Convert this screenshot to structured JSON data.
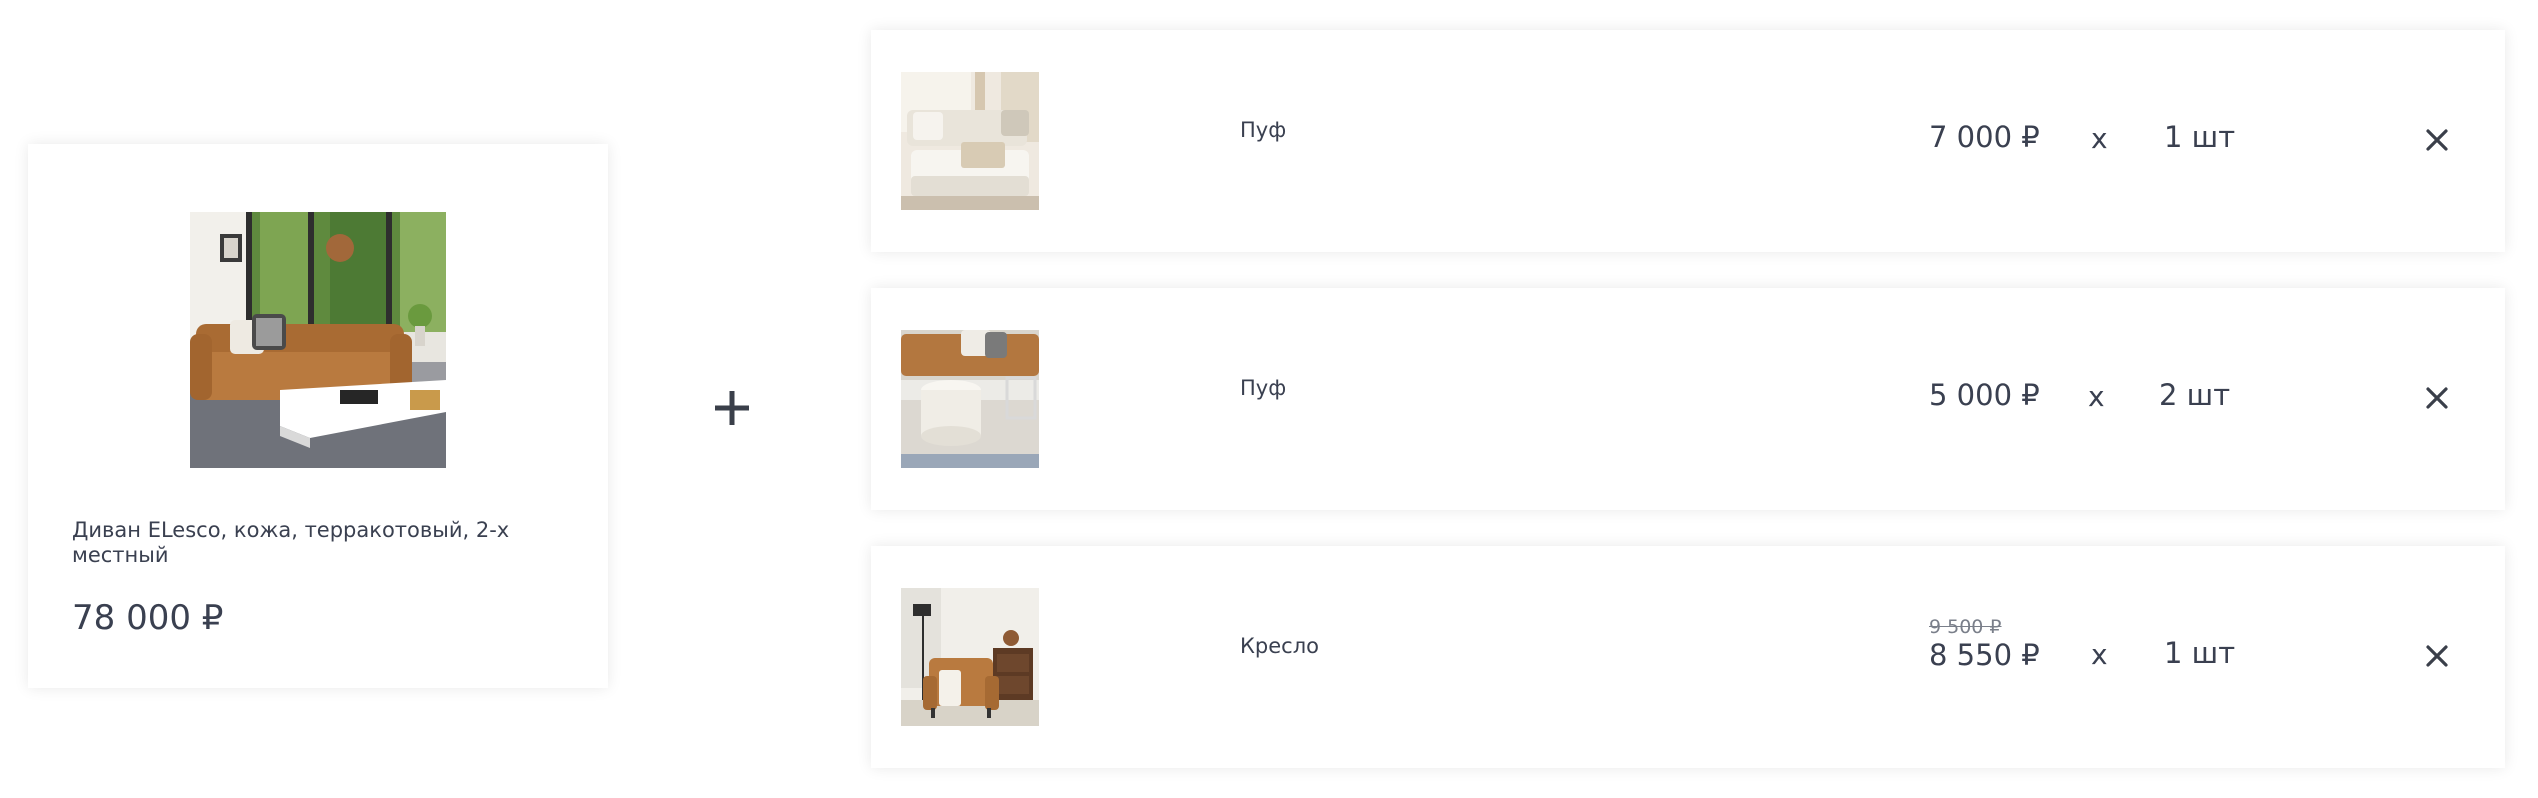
{
  "main_product": {
    "title": "Диван ELesco, кожа, терракотовый, 2-х местный",
    "price": "78 000 ₽",
    "image_icon": "sofa-photo"
  },
  "plus_icon": "plus-icon",
  "accessories": [
    {
      "name": "Пуф",
      "price": "7 000 ₽",
      "times": "x",
      "quantity": "1 шт",
      "image_icon": "white-pouf-photo",
      "remove_icon": "close-icon"
    },
    {
      "name": "Пуф",
      "price": "5 000 ₽",
      "times": "x",
      "quantity": "2 шт",
      "image_icon": "round-pouf-photo",
      "remove_icon": "close-icon"
    },
    {
      "name": "Кресло",
      "old_price": "9 500 ₽",
      "price": "8 550 ₽",
      "times": "x",
      "quantity": "1 шт",
      "image_icon": "armchair-photo",
      "remove_icon": "close-icon"
    }
  ],
  "colors": {
    "text": "#3a4050",
    "card_bg": "#ffffff",
    "sofa_leather": "#b97a3f"
  }
}
